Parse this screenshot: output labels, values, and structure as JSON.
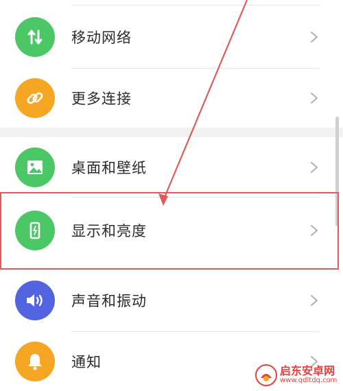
{
  "settings": {
    "items": [
      {
        "label": "移动网络",
        "icon": "mobile-network-icon",
        "color": "#4cc766"
      },
      {
        "label": "更多连接",
        "icon": "link-icon",
        "color": "#f5a623"
      },
      {
        "label": "桌面和壁纸",
        "icon": "image-icon",
        "color": "#4cc766"
      },
      {
        "label": "显示和亮度",
        "icon": "phone-display-icon",
        "color": "#4cc766"
      },
      {
        "label": "声音和振动",
        "icon": "speaker-icon",
        "color": "#5264e0"
      },
      {
        "label": "通知",
        "icon": "bell-icon",
        "color": "#f5a623"
      }
    ],
    "highlighted_item": "显示和亮度"
  },
  "annotation": {
    "arrow_color": "#e05a5a",
    "box_color": "#e05a5a"
  },
  "watermark": {
    "title": "启东安卓网",
    "url": "www.qdltdq.com"
  }
}
